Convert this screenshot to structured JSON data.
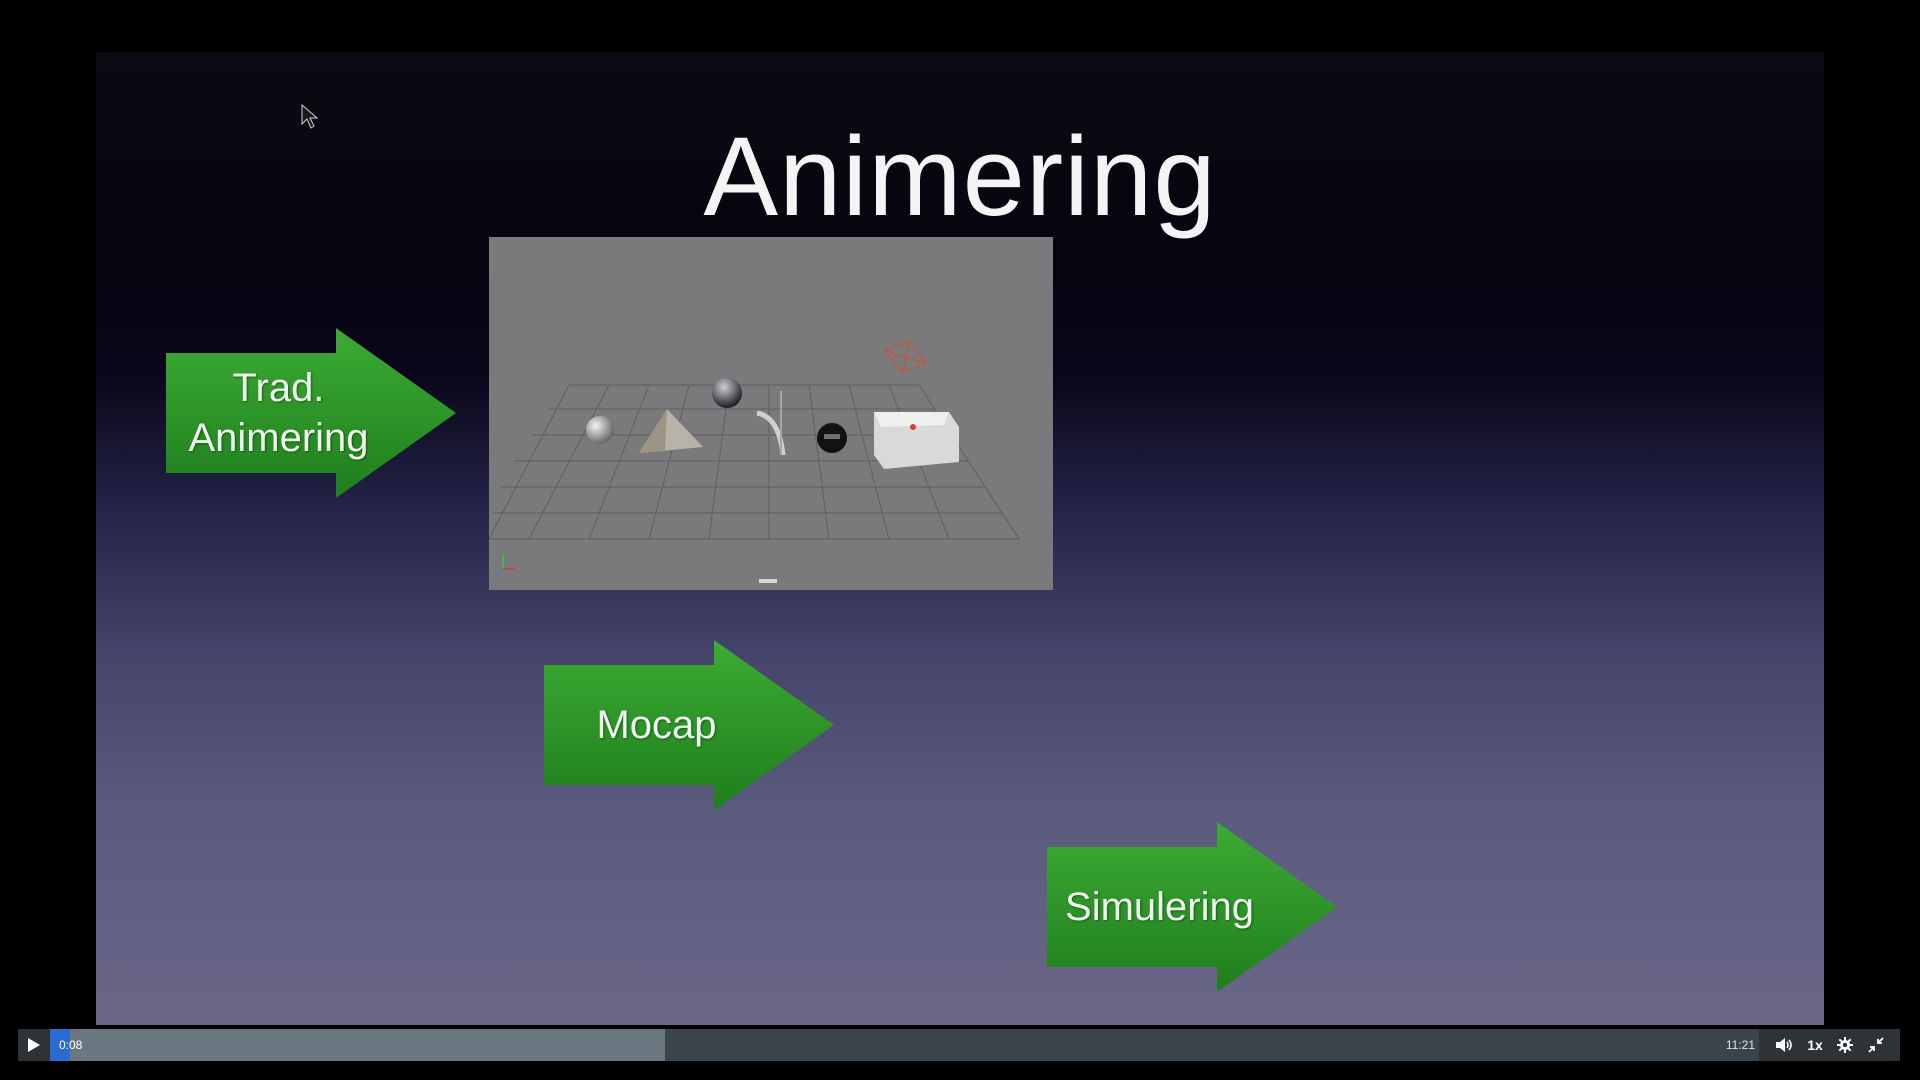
{
  "slide": {
    "title": "Animering",
    "arrows": [
      {
        "label_line1": "Trad.",
        "label_line2": "Animering"
      },
      {
        "label": "Mocap"
      },
      {
        "label": "Simulering"
      }
    ],
    "colors": {
      "arrow_green": "#2f9a2a",
      "background_top": "#08040f",
      "background_bottom": "#6a6688"
    }
  },
  "player": {
    "current_time": "0:08",
    "duration": "11:21",
    "speed": "1x",
    "played_fraction": 0.0118,
    "buffered_fraction": 0.36,
    "icons": {
      "play": "play-icon",
      "volume": "volume-icon",
      "settings": "gear-icon",
      "exit_fullscreen": "exit-fullscreen-icon"
    },
    "colors": {
      "bar": "#2e3338",
      "played": "#2a6bd0",
      "buffered": "#6b7780"
    }
  }
}
